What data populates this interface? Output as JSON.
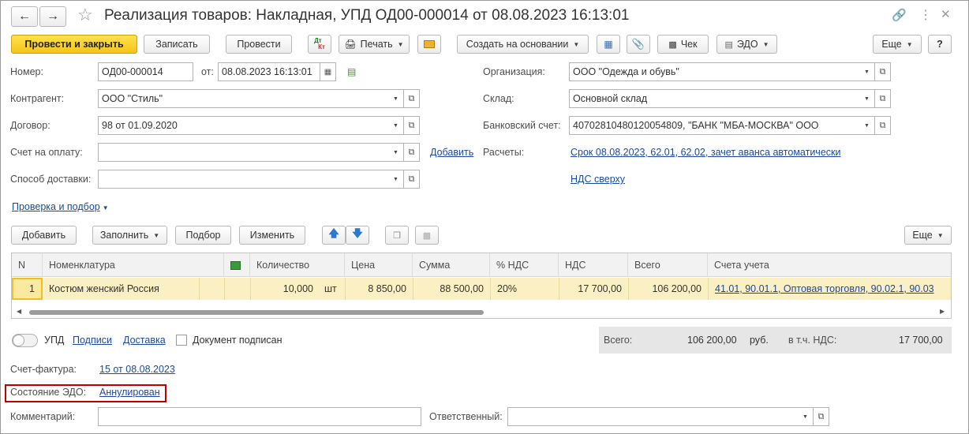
{
  "title": "Реализация товаров: Накладная, УПД ОД00-000014 от 08.08.2023 16:13:01",
  "toolbar": {
    "post_close": "Провести и закрыть",
    "write": "Записать",
    "post": "Провести",
    "print": "Печать",
    "create_based": "Создать на основании",
    "check": "Чек",
    "edo": "ЭДО",
    "more": "Еще",
    "help": "?",
    "dtkt_top": "Дт",
    "dtkt_bottom": "Кт"
  },
  "fields": {
    "number_label": "Номер:",
    "number_value": "ОД00-000014",
    "from_label": "от:",
    "date_value": "08.08.2023 16:13:01",
    "counterparty_label": "Контрагент:",
    "counterparty_value": "ООО \"Стиль\"",
    "contract_label": "Договор:",
    "contract_value": "98 от 01.09.2020",
    "invoice_pay_label": "Счет на оплату:",
    "invoice_pay_value": "",
    "add_link": "Добавить",
    "delivery_label": "Способ доставки:",
    "delivery_value": "",
    "org_label": "Организация:",
    "org_value": "ООО \"Одежда и обувь\"",
    "warehouse_label": "Склад:",
    "warehouse_value": "Основной склад",
    "bank_label": "Банковский счет:",
    "bank_value": "40702810480120054809, \"БАНК \"МБА-МОСКВА\" ООО",
    "settlements_label": "Расчеты:",
    "settlements_link": "Срок 08.08.2023, 62.01, 62.02, зачет аванса автоматически",
    "vat_link": "НДС сверху",
    "check_link": "Проверка и подбор"
  },
  "table_toolbar": {
    "add": "Добавить",
    "fill": "Заполнить",
    "select": "Подбор",
    "change": "Изменить",
    "more": "Еще"
  },
  "table": {
    "headers": [
      "N",
      "Номенклатура",
      "Количество",
      "Цена",
      "Сумма",
      "% НДС",
      "НДС",
      "Всего",
      "Счета учета"
    ],
    "rows": [
      {
        "n": "1",
        "item": "Костюм женский Россия",
        "qty": "10,000",
        "unit": "шт",
        "price": "8 850,00",
        "sum": "88 500,00",
        "vat_rate": "20%",
        "vat": "17 700,00",
        "total": "106 200,00",
        "accounts": "41.01, 90.01.1, Оптовая торговля, 90.02.1, 90.03"
      }
    ]
  },
  "footer": {
    "upd_label": "УПД",
    "signatures_link": "Подписи",
    "delivery_link": "Доставка",
    "signed_label": "Документ подписан",
    "total_label": "Всего:",
    "total_value": "106 200,00",
    "currency": "руб.",
    "vat_incl_label": "в т.ч. НДС:",
    "vat_incl_value": "17 700,00",
    "invoice_label": "Счет-фактура:",
    "invoice_link": "15 от 08.08.2023",
    "edo_state_label": "Состояние ЭДО:",
    "edo_state_link": "Аннулирован",
    "comment_label": "Комментарий:",
    "comment_value": "",
    "responsible_label": "Ответственный:",
    "responsible_value": ""
  },
  "colors": {
    "primary_button": "#f5c518",
    "selected_row": "#fbf0c3",
    "link": "#1a4a9c",
    "highlight_box": "#c00000",
    "totals_panel": "#e6e6e6"
  }
}
